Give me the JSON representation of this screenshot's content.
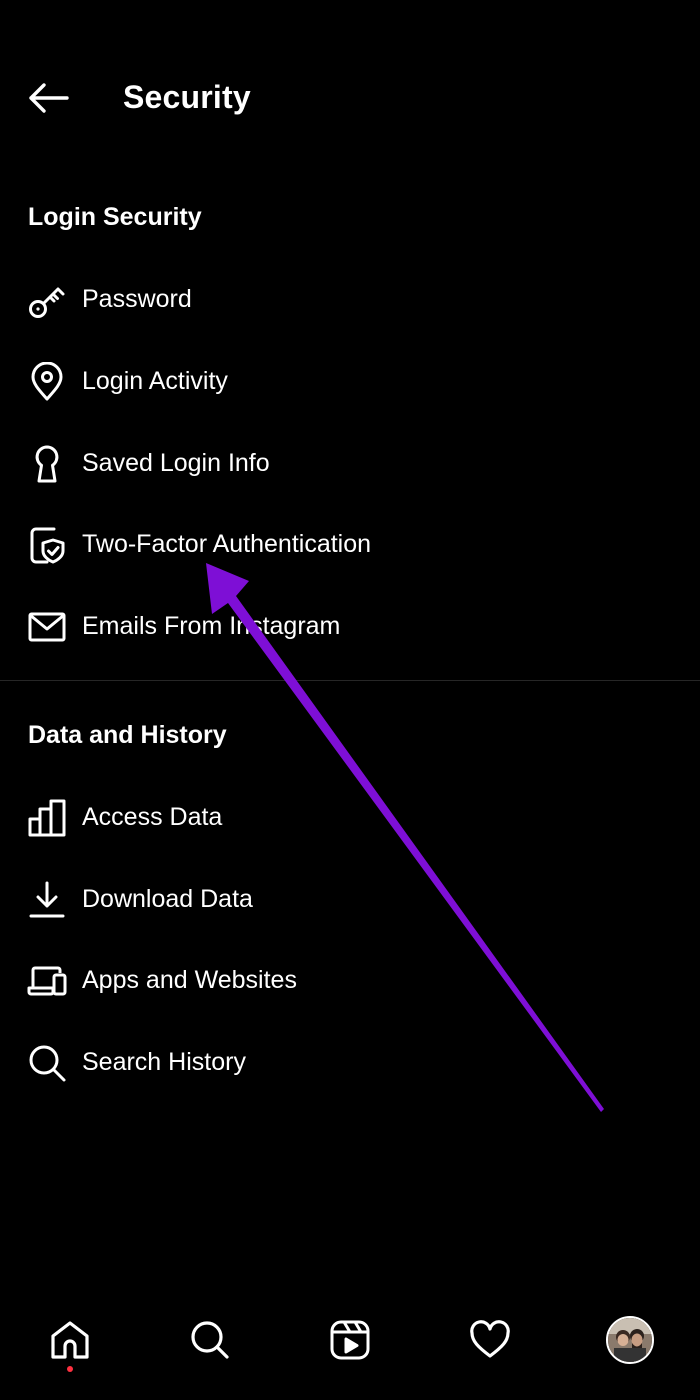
{
  "header": {
    "back_icon": "arrow-left-icon",
    "title": "Security"
  },
  "sections": [
    {
      "title": "Login Security",
      "items": [
        {
          "label": "Password",
          "icon": "key-icon"
        },
        {
          "label": "Login Activity",
          "icon": "location-pin-icon"
        },
        {
          "label": "Saved Login Info",
          "icon": "keyhole-icon"
        },
        {
          "label": "Two-Factor Authentication",
          "icon": "shield-check-icon"
        },
        {
          "label": "Emails From Instagram",
          "icon": "envelope-icon"
        }
      ]
    },
    {
      "title": "Data and History",
      "items": [
        {
          "label": "Access Data",
          "icon": "bar-chart-icon"
        },
        {
          "label": "Download Data",
          "icon": "download-icon"
        },
        {
          "label": "Apps and Websites",
          "icon": "devices-icon"
        },
        {
          "label": "Search History",
          "icon": "search-icon"
        }
      ]
    }
  ],
  "bottom_nav": [
    {
      "name": "home",
      "icon": "home-icon",
      "has_notification_dot": true
    },
    {
      "name": "search",
      "icon": "search-icon"
    },
    {
      "name": "reels",
      "icon": "reels-icon"
    },
    {
      "name": "activity",
      "icon": "heart-icon"
    },
    {
      "name": "profile",
      "icon": "avatar"
    }
  ],
  "colors": {
    "background": "#000000",
    "text": "#ffffff",
    "divider": "#262626",
    "annotation_arrow": "#7e0fd6",
    "notification_dot": "#ff3040"
  }
}
